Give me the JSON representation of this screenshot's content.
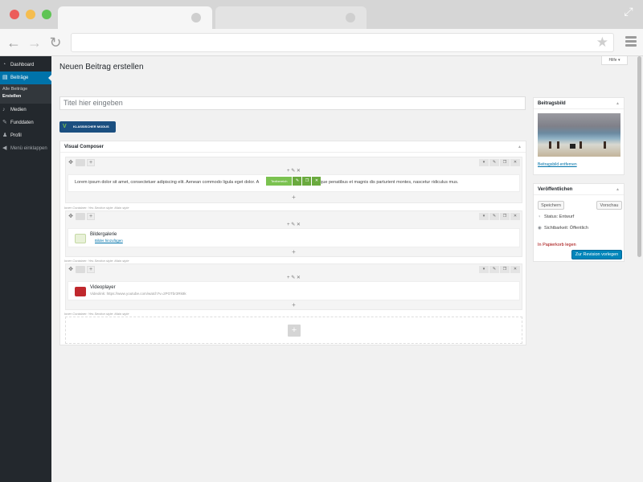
{
  "browser": {
    "icons": {
      "back": "arrow-left-icon",
      "forward": "arrow-right-icon",
      "reload": "reload-icon",
      "bookmark": "star-icon",
      "menu": "hamburger-menu-icon",
      "expand": "expand-icon"
    }
  },
  "sidebar": {
    "items": [
      {
        "label": "Dashboard",
        "icon": "dashboard-icon"
      },
      {
        "label": "Beiträge",
        "icon": "posts-icon"
      },
      {
        "label": "Medien",
        "icon": "media-icon"
      },
      {
        "label": "Funddaten",
        "icon": "pin-icon"
      },
      {
        "label": "Profil",
        "icon": "user-icon"
      },
      {
        "label": "Menü einklappen",
        "icon": "collapse-icon"
      }
    ],
    "submenu": [
      "Alle Beiträge",
      "Erstellen"
    ]
  },
  "page": {
    "title": "Neuen Beitrag erstellen",
    "help": "Hilfe ▾",
    "title_placeholder": "Titel hier eingeben",
    "classic_mode": "KLASSISCHER MODUS"
  },
  "vc": {
    "header": "Visual Composer",
    "inner_label": "Inner Container: Yes  Section style: Main style",
    "text_block": {
      "label": "Textbereich",
      "content": "Lorem ipsum dolor sit amet, consectetuer adipiscing elit. Aenean commodo ligula eget dolor. A",
      "content_end": "que penatibus et magnis dis parturient montes, nascetur ridiculus mus."
    },
    "gallery": {
      "title": "Bildergalerie",
      "link": "Bilder hinzufügen"
    },
    "video": {
      "title": "Videoplayer",
      "subtitle": "Videolink: https://www.youtube.com/watch?v=2POTbr3Rk8k"
    }
  },
  "featured_image": {
    "title": "Beitragsbild",
    "remove": "Beitragsbild entfernen"
  },
  "publish": {
    "title": "Veröffentlichen",
    "save": "Speichern",
    "preview": "Vorschau",
    "status": "Status: Entwurf",
    "visibility": "Sichtbarkeit: Öffentlich",
    "trash": "In Papierkorb legen",
    "submit": "Zur Revision vorlegen"
  },
  "colors": {
    "admin_bar": "#23282d",
    "admin_accent": "#0073aa",
    "vc_green": "#7bc250",
    "vc_blue": "#1b4f80",
    "video_red": "#c0282d",
    "primary_button": "#0085ba"
  }
}
